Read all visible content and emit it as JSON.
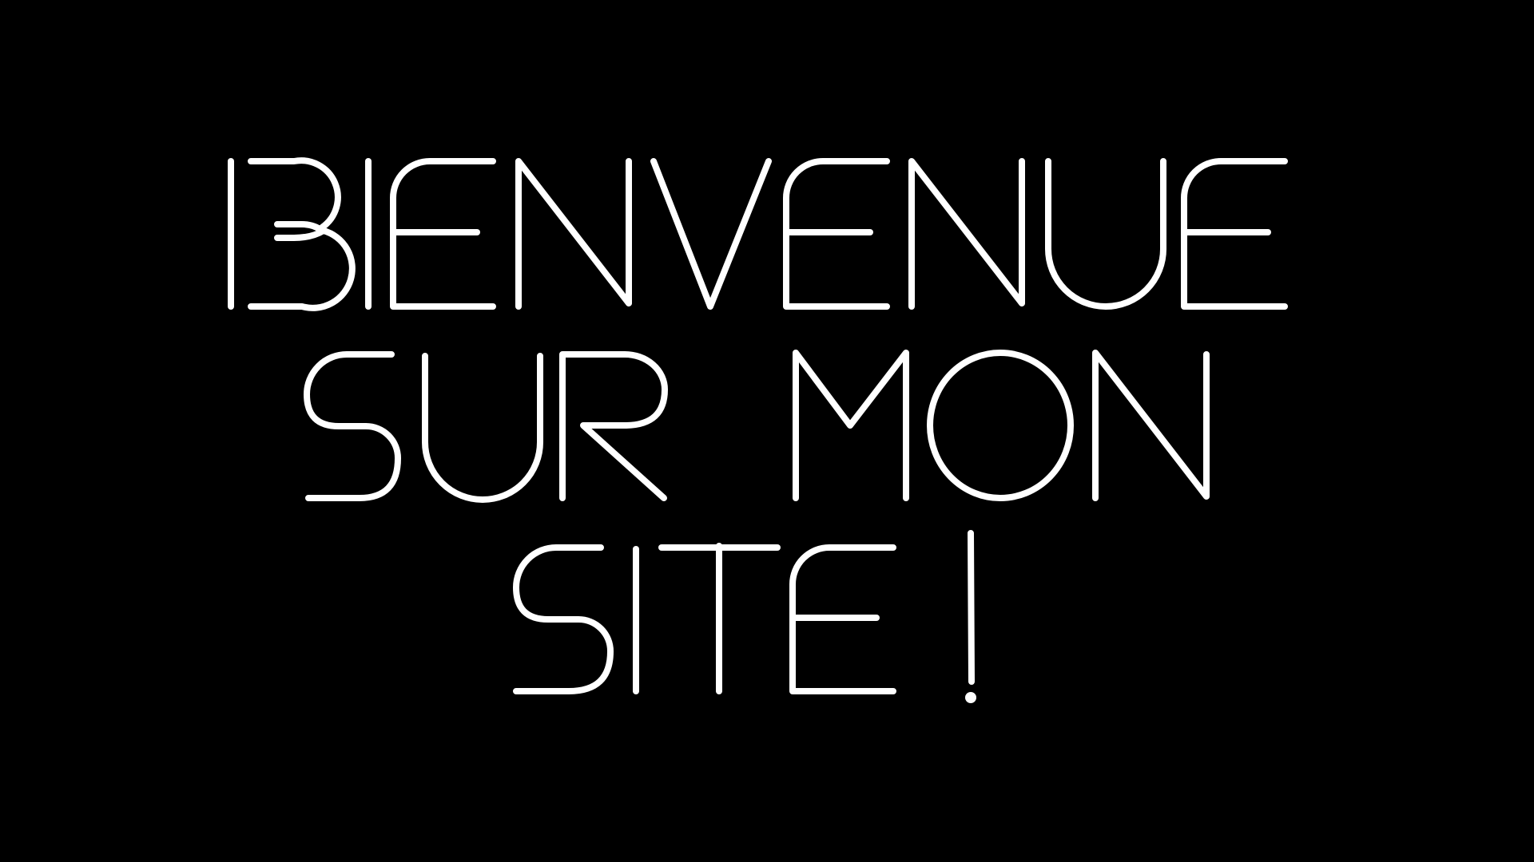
{
  "page": {
    "background_color": "#000000",
    "text_color": "#ffffff"
  },
  "greeting": {
    "line1": "BIENVENUE",
    "line2": "SUR MON",
    "line3": "SITE !"
  }
}
